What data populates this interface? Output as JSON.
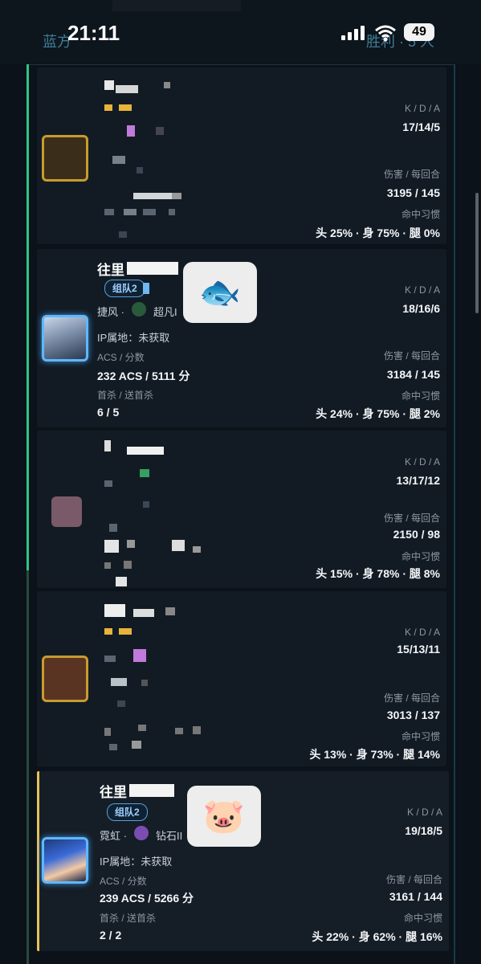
{
  "status_bar": {
    "time": "21:11",
    "battery": "49"
  },
  "header": {
    "team_left": "蓝方",
    "team_right": "胜利 · 5 人"
  },
  "labels": {
    "kda": "K / D / A",
    "damage": "伤害 / 每回合",
    "habit": "命中习惯",
    "acs": "ACS / 分数",
    "firstkill": "首杀 / 送首杀",
    "ip": "IP属地：未获取"
  },
  "players": [
    {
      "kda": "17/14/5",
      "damage": "3195 / 145",
      "habit": "头 25% · 身 75% · 腿 0%"
    },
    {
      "name": "往里",
      "party": "组队2",
      "agent": "捷风 ·",
      "rank": "超凡I",
      "acs": "232 ACS / 5111 分",
      "firstkill": "6 / 5",
      "kda": "18/16/6",
      "damage": "3184 / 145",
      "habit": "头 24% · 身 75% · 腿 2%",
      "emoji": "🐟"
    },
    {
      "kda": "13/17/12",
      "damage": "2150 / 98",
      "habit": "头 15% · 身 78% · 腿 8%"
    },
    {
      "kda": "15/13/11",
      "damage": "3013 / 137",
      "habit": "头 13% · 身 73% · 腿 14%"
    },
    {
      "name": "往里",
      "party": "组队2",
      "agent": "霓虹 ·",
      "rank": "钻石II",
      "acs": "239 ACS / 5266 分",
      "firstkill": "2 / 2",
      "kda": "19/18/5",
      "damage": "3161 / 144",
      "habit": "头 22% · 身 62% · 腿 16%",
      "emoji": "🐷"
    }
  ],
  "colors": {
    "accent_gold": "#e7c25a",
    "accent_blue": "#5fb8ff",
    "rail_green": "#2fc487"
  }
}
